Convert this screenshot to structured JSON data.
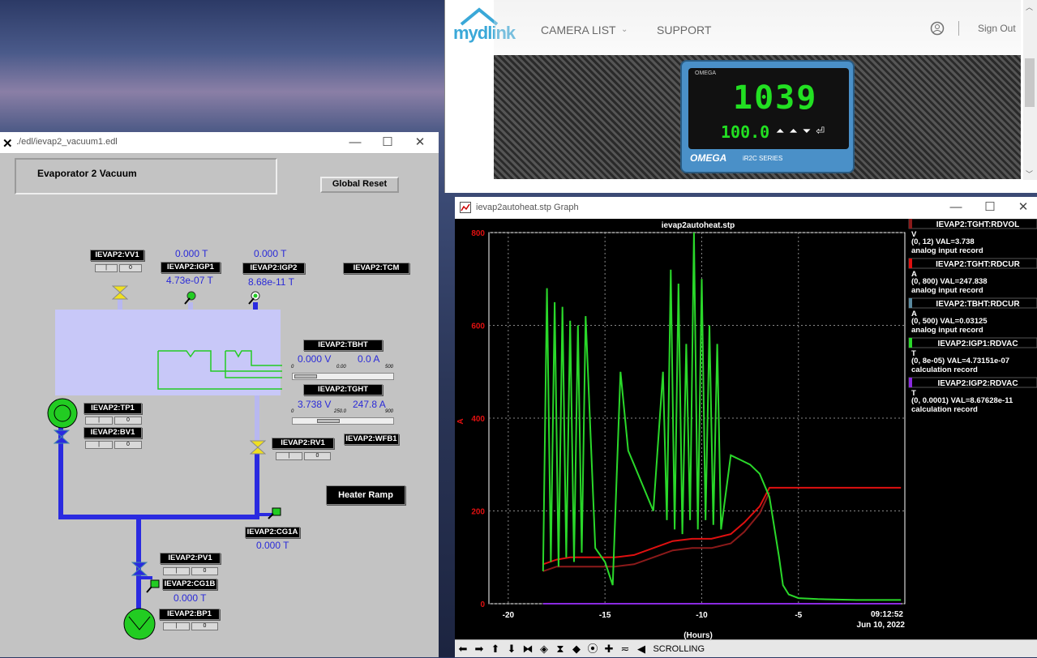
{
  "edl_window": {
    "title": "./edl/ievap2_vacuum1.edl",
    "header": "Evaporator 2 Vacuum",
    "global_reset": "Global Reset",
    "heater_ramp": "Heater Ramp",
    "pvs": {
      "vv1": "IEVAP2:VV1",
      "igp1": "IEVAP2:IGP1",
      "igp2": "IEVAP2:IGP2",
      "tcm": "IEVAP2:TCM",
      "tbht": "IEVAP2:TBHT",
      "tght": "IEVAP2:TGHT",
      "tp1": "IEVAP2:TP1",
      "bv1": "IEVAP2:BV1",
      "rv1": "IEVAP2:RV1",
      "wfb1": "IEVAP2:WFB1",
      "cg1a": "IEVAP2:CG1A",
      "pv1": "IEVAP2:PV1",
      "cg1b": "IEVAP2:CG1B",
      "bp1": "IEVAP2:BP1"
    },
    "values": {
      "igp1_sp": "0.000 T",
      "igp1_rb": "4.73e-07 T",
      "igp2_sp": "0.000 T",
      "igp2_rb": "8.68e-11 T",
      "tbht_v": "0.000 V",
      "tbht_a": "0.0 A",
      "tght_v": "3.738 V",
      "tght_a": "247.8 A",
      "cg1a": "0.000 T",
      "cg1b": "0.000 T"
    },
    "scales": {
      "tbht_min": "0",
      "tbht_mid": "0.00",
      "tbht_max": "500",
      "tght_min": "0",
      "tght_mid": "250.0",
      "tght_max": "900"
    },
    "ctrl_off": "|",
    "ctrl_on": "0"
  },
  "camera_window": {
    "logo": "mydlink",
    "nav": [
      "CAMERA LIST",
      "SUPPORT"
    ],
    "sign_out": "Sign Out",
    "device_brand": "OMEGA",
    "device_model": "iR2C SERIES",
    "pv_display": "1039",
    "sv_display": "100.0"
  },
  "graph_window": {
    "title": "ievap2autoheat.stp Graph",
    "status": "SCROLLING"
  },
  "chart_data": {
    "type": "line",
    "title": "ievap2autoheat.stp",
    "xlabel": "(Hours)",
    "ylabel": "A",
    "xlim": [
      -21,
      0.5
    ],
    "ylim": [
      0,
      800
    ],
    "x_ticks": [
      -20,
      -15,
      -10,
      -5
    ],
    "y_ticks": [
      0,
      200,
      400,
      600,
      800
    ],
    "timestamp": "09:12:52",
    "date": "Jun 10, 2022",
    "grid": true,
    "legend_position": "right",
    "legend": [
      {
        "name": "IEVAP2:TGHT:RDVOL",
        "unit": "V",
        "range": "(0, 12) VAL=3.738",
        "rtype": "analog input record",
        "color": "#8b1a1a"
      },
      {
        "name": "IEVAP2:TGHT:RDCUR",
        "unit": "A",
        "range": "(0, 800) VAL=247.838",
        "rtype": "analog input record",
        "color": "#e01010"
      },
      {
        "name": "IEVAP2:TBHT:RDCUR",
        "unit": "A",
        "range": "(0, 500) VAL=0.03125",
        "rtype": "analog input record",
        "color": "#5a8aa0"
      },
      {
        "name": "IEVAP2:IGP1:RDVAC",
        "unit": "T",
        "range": "(0, 8e-05) VAL=4.73151e-07",
        "rtype": "calculation record",
        "color": "#2ad82a"
      },
      {
        "name": "IEVAP2:IGP2:RDVAC",
        "unit": "T",
        "range": "(0, 0.0001) VAL=8.67628e-11",
        "rtype": "calculation record",
        "color": "#8a2ae0"
      }
    ],
    "series": [
      {
        "name": "IEVAP2:TGHT:RDCUR",
        "color": "#e01010",
        "x": [
          -18.2,
          -17.5,
          -16.8,
          -15.5,
          -14.5,
          -13.5,
          -12.5,
          -11.5,
          -10.5,
          -9.5,
          -8.5,
          -7.8,
          -7,
          -6.5,
          -5,
          -3,
          -1,
          0.3
        ],
        "y": [
          85,
          95,
          100,
          100,
          100,
          105,
          120,
          135,
          140,
          140,
          150,
          175,
          210,
          250,
          250,
          250,
          250,
          250
        ]
      },
      {
        "name": "IEVAP2:TGHT:RDVOL",
        "color": "#8b1a1a",
        "x": [
          -18.2,
          -17.5,
          -16.8,
          -15.5,
          -14.5,
          -13.5,
          -12.5,
          -11.5,
          -10.5,
          -9.5,
          -8.5,
          -7.8,
          -7,
          -6.5
        ],
        "y": [
          70,
          80,
          80,
          80,
          80,
          85,
          100,
          115,
          120,
          120,
          130,
          155,
          195,
          240
        ]
      },
      {
        "name": "IEVAP2:IGP1:RDVAC",
        "color": "#2ad82a",
        "x": [
          -18.2,
          -18,
          -17.8,
          -17.6,
          -17.4,
          -17.2,
          -17,
          -16.8,
          -16.6,
          -16.4,
          -16.2,
          -16,
          -15.5,
          -15,
          -14.6,
          -14.2,
          -13.8,
          -13.5,
          -13,
          -12.5,
          -12,
          -11.8,
          -11.6,
          -11.4,
          -11.2,
          -11,
          -10.8,
          -10.6,
          -10.4,
          -10.2,
          -10,
          -9.8,
          -9.6,
          -9.4,
          -9.2,
          -9,
          -8.5,
          -8,
          -7.5,
          -7,
          -6.5,
          -6,
          -5.8,
          -5.5,
          -5,
          -4,
          -2,
          0.3
        ],
        "y": [
          70,
          680,
          90,
          650,
          80,
          640,
          100,
          610,
          90,
          600,
          110,
          620,
          120,
          90,
          40,
          500,
          330,
          300,
          250,
          200,
          500,
          180,
          720,
          160,
          690,
          150,
          560,
          180,
          800,
          160,
          700,
          180,
          600,
          170,
          560,
          160,
          320,
          310,
          300,
          280,
          230,
          100,
          40,
          20,
          12,
          10,
          8,
          8
        ]
      },
      {
        "name": "IEVAP2:IGP2:RDVAC",
        "color": "#8a2ae0",
        "x": [
          -18.2,
          0.3
        ],
        "y": [
          0,
          0
        ]
      }
    ]
  }
}
